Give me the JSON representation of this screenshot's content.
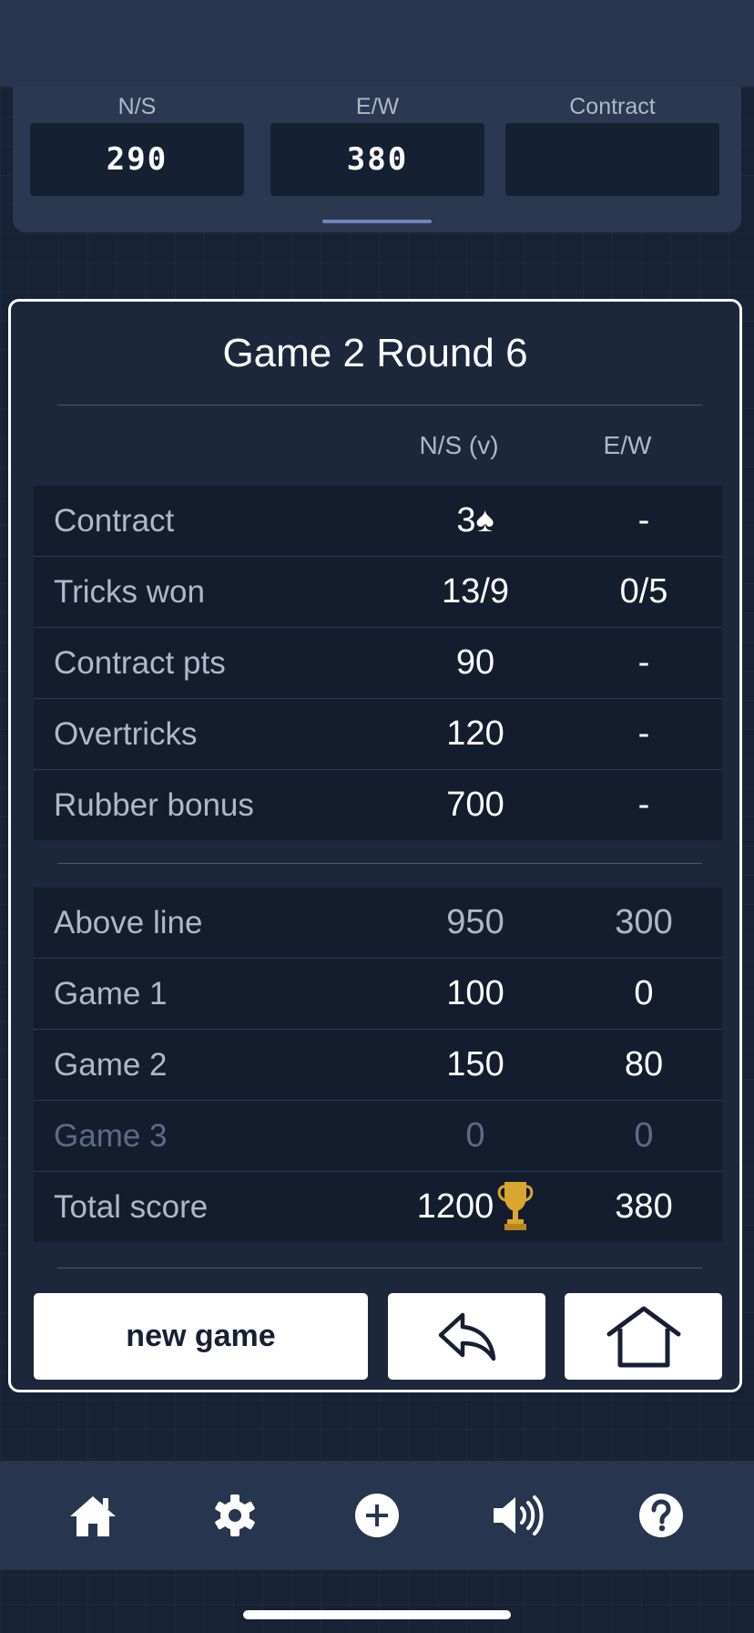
{
  "header": {
    "ns_label": "N/S",
    "ew_label": "E/W",
    "contract_label": "Contract",
    "ns_score": "290",
    "ew_score": "380",
    "contract_value": ""
  },
  "card": {
    "title": "Game 2 Round 6",
    "col_ns": "N/S (v)",
    "col_ew": "E/W",
    "round_rows": [
      {
        "label": "Contract",
        "ns": "3♠",
        "ew": "-"
      },
      {
        "label": "Tricks won",
        "ns": "13/9",
        "ew": "0/5"
      },
      {
        "label": "Contract pts",
        "ns": "90",
        "ew": "-"
      },
      {
        "label": "Overtricks",
        "ns": "120",
        "ew": "-"
      },
      {
        "label": "Rubber bonus",
        "ns": "700",
        "ew": "-"
      }
    ],
    "total_rows": [
      {
        "label": "Above line",
        "ns": "950",
        "ew": "300"
      },
      {
        "label": "Game 1",
        "ns": "100",
        "ew": "0"
      },
      {
        "label": "Game 2",
        "ns": "150",
        "ew": "80"
      },
      {
        "label": "Game 3",
        "ns": "0",
        "ew": "0"
      },
      {
        "label": "Total score",
        "ns": "1200",
        "ew": "380"
      }
    ],
    "new_game_label": "new game"
  },
  "icons": {
    "trophy": "trophy-icon",
    "undo": "undo-arrow-icon",
    "home_button": "house-outline-icon",
    "nav": [
      "home-icon",
      "gear-icon",
      "plus-circle-icon",
      "speaker-icon",
      "help-icon"
    ]
  },
  "colors": {
    "background": "#182235",
    "panel": "#2a3852",
    "table": "#141d2d",
    "muted_text": "#aeb8c9",
    "dim_text": "#5e6b82",
    "accent_line": "#6e85b5",
    "trophy": "#d9a62e"
  }
}
